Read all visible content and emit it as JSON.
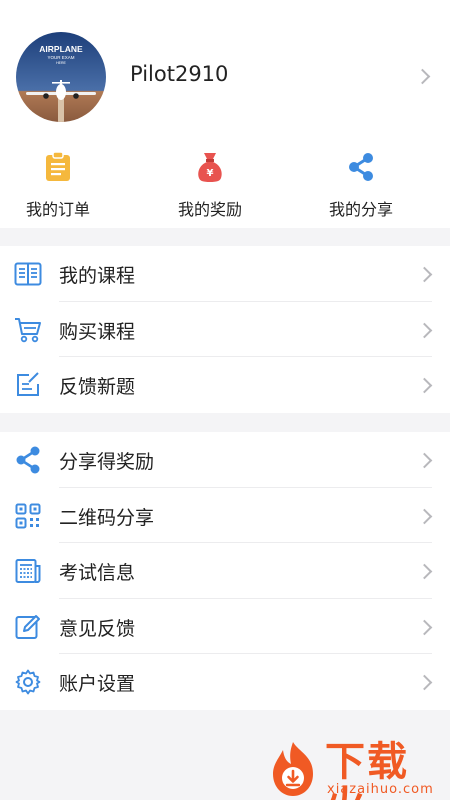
{
  "profile": {
    "avatar_text": [
      "AIRPLANE",
      "YOUR EXAM",
      "HERE"
    ],
    "username": "Pilot2910"
  },
  "quick_actions": [
    {
      "label": "我的订单",
      "icon": "clipboard-icon",
      "color": "#f5b83d"
    },
    {
      "label": "我的奖励",
      "icon": "money-bag-icon",
      "color": "#e8534f"
    },
    {
      "label": "我的分享",
      "icon": "share-icon",
      "color": "#3d8be0"
    }
  ],
  "menu_group_1": [
    {
      "label": "我的课程",
      "icon": "book-icon"
    },
    {
      "label": "购买课程",
      "icon": "cart-icon"
    },
    {
      "label": "反馈新题",
      "icon": "edit-note-icon"
    }
  ],
  "menu_group_2": [
    {
      "label": "分享得奖励",
      "icon": "share-icon"
    },
    {
      "label": "二维码分享",
      "icon": "qr-code-icon"
    },
    {
      "label": "考试信息",
      "icon": "newspaper-icon"
    },
    {
      "label": "意见反馈",
      "icon": "pencil-edit-icon"
    },
    {
      "label": "账户设置",
      "icon": "gear-icon"
    }
  ],
  "watermark": {
    "brand": "下载火",
    "url": "xiazaihuo.com"
  },
  "colors": {
    "icon_blue": "#3d8be0",
    "brand_orange": "#f05a24"
  }
}
